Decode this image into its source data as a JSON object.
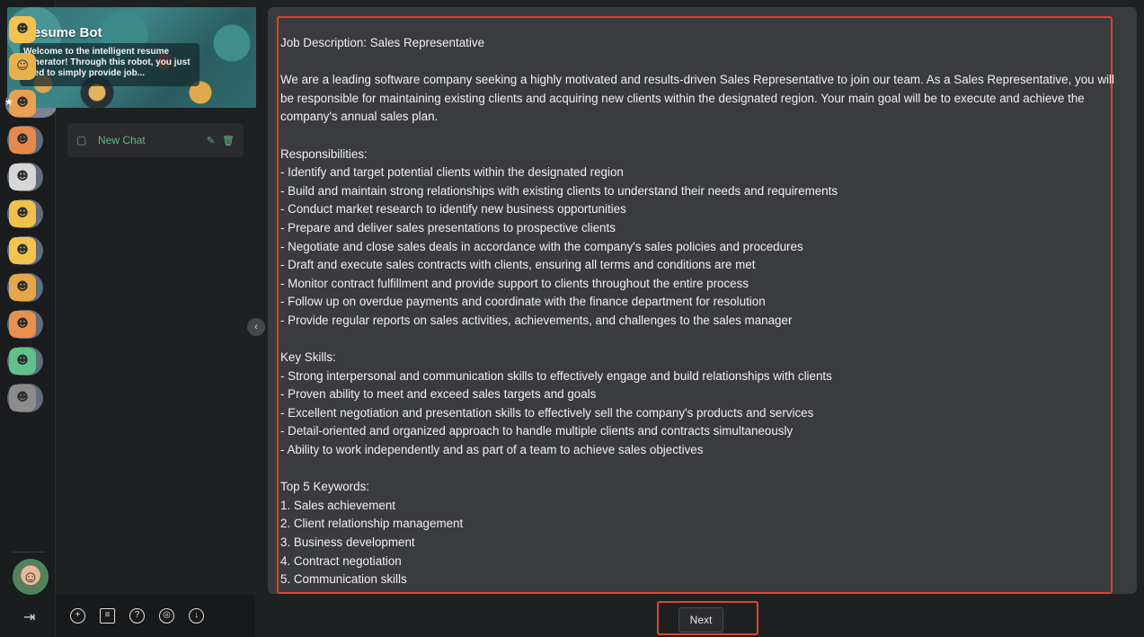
{
  "bots": [
    {
      "name": "bot-1",
      "face": "☻",
      "color": "#f2c14e",
      "active": false,
      "starred": false
    },
    {
      "name": "bot-2",
      "face": "☺",
      "color": "#e8b24a",
      "active": false,
      "starred": false
    },
    {
      "name": "bot-3",
      "face": "☻",
      "color": "#e9a050",
      "active": true,
      "starred": true
    },
    {
      "name": "bot-4",
      "face": "☻",
      "color": "#e58a4a",
      "active": false,
      "starred": false
    },
    {
      "name": "bot-5",
      "face": "☻",
      "color": "#d7d7d7",
      "active": false,
      "starred": false
    },
    {
      "name": "bot-6",
      "face": "☻",
      "color": "#f0c04a",
      "active": false,
      "starred": false
    },
    {
      "name": "bot-7",
      "face": "☻",
      "color": "#f2c44e",
      "active": false,
      "starred": false
    },
    {
      "name": "bot-8",
      "face": "☻",
      "color": "#e6a64a",
      "active": false,
      "starred": false
    },
    {
      "name": "bot-9",
      "face": "☻",
      "color": "#e9914c",
      "active": false,
      "starred": false
    },
    {
      "name": "bot-10",
      "face": "☻",
      "color": "#5ec28a",
      "active": false,
      "starred": false
    },
    {
      "name": "bot-11",
      "face": "☻",
      "color": "#8c8c8c",
      "active": false,
      "starred": false
    }
  ],
  "banner": {
    "title": "Resume Bot",
    "description": "Welcome to the intelligent resume generator! Through this robot, you just need to simply provide job..."
  },
  "chat": {
    "label": "New Chat",
    "bubble_icon": "▢",
    "edit_icon": "✎",
    "delete_icon": "🗑"
  },
  "collapse_icon": "‹",
  "footer_icons": {
    "add": "+",
    "document": "≡",
    "help": "?",
    "camera": "◎",
    "download": "↓"
  },
  "logout_icon": "⇥",
  "document": {
    "heading": "Job Description: Sales Representative",
    "intro": "We are a leading software company seeking a highly motivated and results-driven Sales Representative to join our team. As a Sales Representative, you will be responsible for maintaining existing clients and acquiring new clients within the designated region. Your main goal will be to execute and achieve the company's annual sales plan.",
    "responsibilities_heading": "Responsibilities:",
    "responsibilities": [
      "- Identify and target potential clients within the designated region",
      "- Build and maintain strong relationships with existing clients to understand their needs and requirements",
      "- Conduct market research to identify new business opportunities",
      "- Prepare and deliver sales presentations to prospective clients",
      "- Negotiate and close sales deals in accordance with the company's sales policies and procedures",
      "- Draft and execute sales contracts with clients, ensuring all terms and conditions are met",
      "- Monitor contract fulfillment and provide support to clients throughout the entire process",
      "- Follow up on overdue payments and coordinate with the finance department for resolution",
      "- Provide regular reports on sales activities, achievements, and challenges to the sales manager"
    ],
    "skills_heading": "Key Skills:",
    "skills": [
      "- Strong interpersonal and communication skills to effectively engage and build relationships with clients",
      "- Proven ability to meet and exceed sales targets and goals",
      "- Excellent negotiation and presentation skills to effectively sell the company's products and services",
      "- Detail-oriented and organized approach to handle multiple clients and contracts simultaneously",
      "- Ability to work independently and as part of a team to achieve sales objectives"
    ],
    "keywords_heading": "Top 5 Keywords:",
    "keywords": [
      "1. Sales achievement",
      "2. Client relationship management",
      "3. Business development",
      "4. Contract negotiation",
      "5. Communication skills"
    ]
  },
  "next_button": "Next",
  "colors": {
    "highlight": "#d9462f",
    "accent": "#5fb884",
    "panel": "#3a3b3e"
  }
}
